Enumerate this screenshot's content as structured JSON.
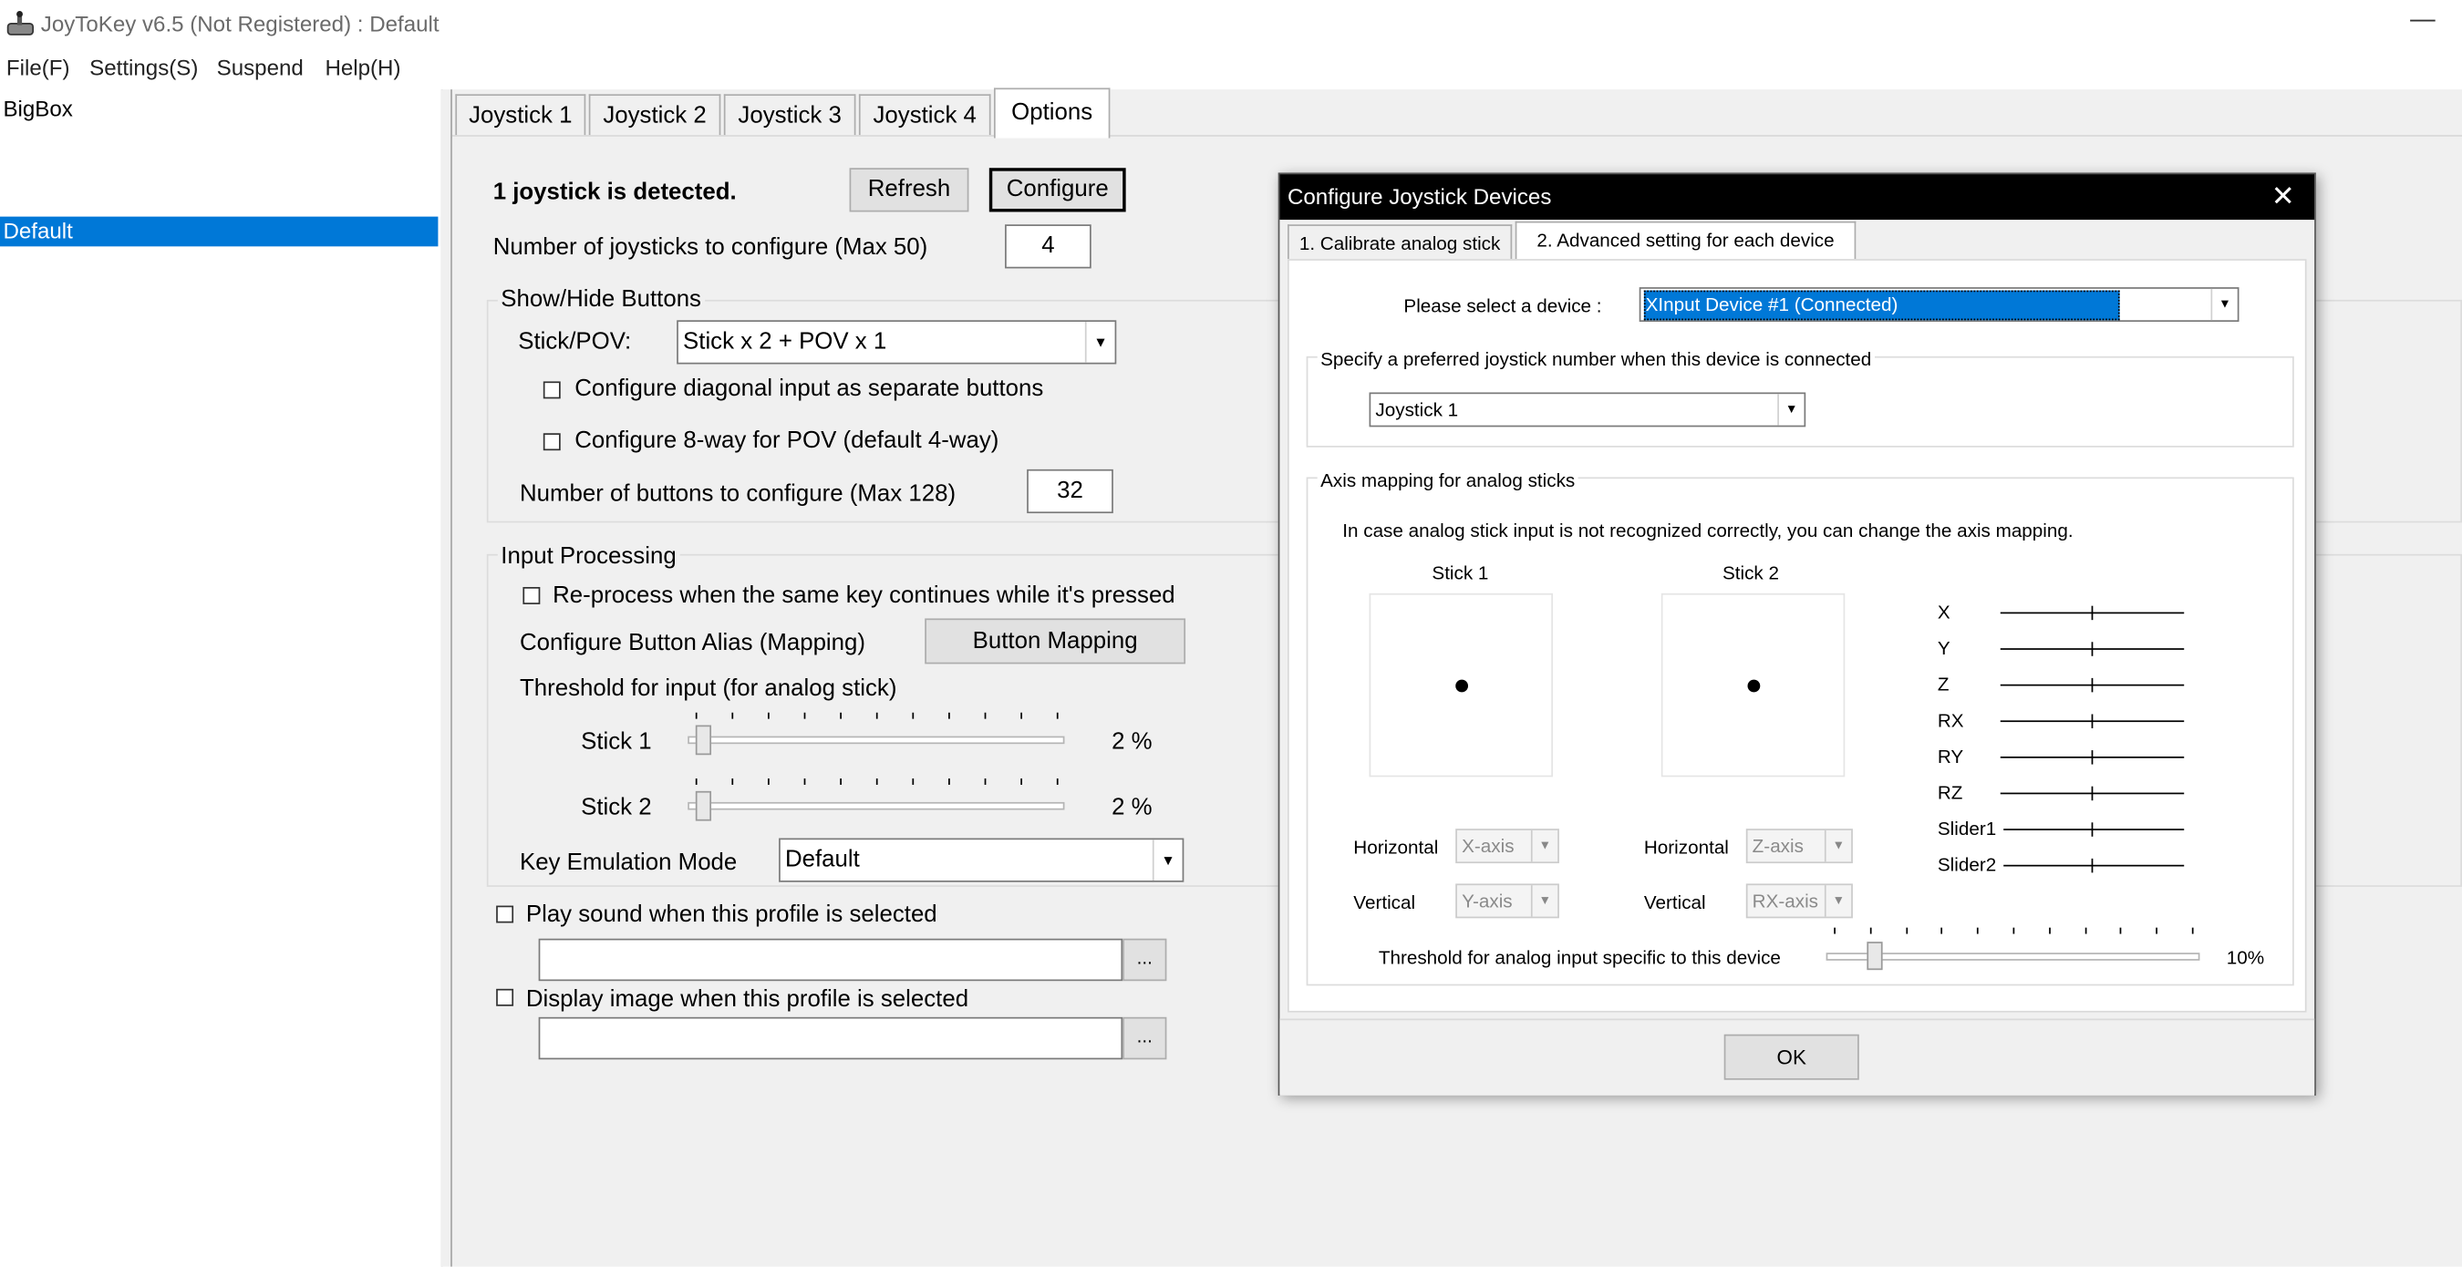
{
  "window": {
    "title": "JoyToKey v6.5 (Not Registered) : Default",
    "minimize_glyph": "—"
  },
  "menu": [
    "File(F)",
    "Settings(S)",
    "Suspend",
    "Help(H)"
  ],
  "profiles": [
    {
      "label": "BigBox",
      "selected": false
    },
    {
      "label": "Default",
      "selected": true
    }
  ],
  "tabs": [
    "Joystick 1",
    "Joystick 2",
    "Joystick 3",
    "Joystick 4",
    "Options"
  ],
  "options": {
    "detected_text": "1 joystick is detected.",
    "refresh_label": "Refresh",
    "configure_label": "Configure",
    "num_joysticks_label": "Number of joysticks to configure (Max 50)",
    "num_joysticks_value": "4",
    "showhide": {
      "title": "Show/Hide Buttons",
      "stick_pov_label": "Stick/POV:",
      "stick_pov_value": "Stick x 2 + POV x 1",
      "diagonal_label": "Configure diagonal input as separate buttons",
      "eightway_label": "Configure 8-way for POV (default 4-way)",
      "num_buttons_label": "Number of buttons to configure (Max 128)",
      "num_buttons_value": "32"
    },
    "input": {
      "title": "Input Processing",
      "reprocess_label": "Re-process when the same key continues while it's pressed",
      "alias_label": "Configure Button Alias (Mapping)",
      "button_mapping_label": "Button Mapping",
      "threshold_label": "Threshold for input (for analog stick)",
      "stick1_label": "Stick 1",
      "stick1_value": "2 %",
      "stick1_level": 0.02,
      "stick2_label": "Stick 2",
      "stick2_value": "2 %",
      "stick2_level": 0.02,
      "key_emulation_label": "Key Emulation Mode",
      "key_emulation_value": "Default"
    },
    "play_sound_label": "Play sound when this profile is selected",
    "display_image_label": "Display image when this profile is selected",
    "browse_label": "..."
  },
  "dialog": {
    "title": "Configure Joystick Devices",
    "close_glyph": "✕",
    "tabs": [
      "1. Calibrate analog stick",
      "2. Advanced setting for each device"
    ],
    "select_device_label": "Please select a device :",
    "select_device_value": "XInput Device #1 (Connected)",
    "preferred_group_title": "Specify a preferred joystick number when this device is connected",
    "preferred_value": "Joystick 1",
    "axis_group_title": "Axis mapping for analog sticks",
    "axis_info": "In case analog stick input is not recognized correctly, you can change the axis mapping.",
    "stick1_title": "Stick 1",
    "stick2_title": "Stick 2",
    "horizontal_label": "Horizontal",
    "vertical_label": "Vertical",
    "stick1_h": "X-axis",
    "stick1_v": "Y-axis",
    "stick2_h": "Z-axis",
    "stick2_v": "RX-axis",
    "axes": [
      "X",
      "Y",
      "Z",
      "RX",
      "RY",
      "RZ",
      "Slider1",
      "Slider2"
    ],
    "threshold_label": "Threshold for analog input specific to this device",
    "threshold_value": "10%",
    "threshold_level": 0.1,
    "ok_label": "OK"
  }
}
